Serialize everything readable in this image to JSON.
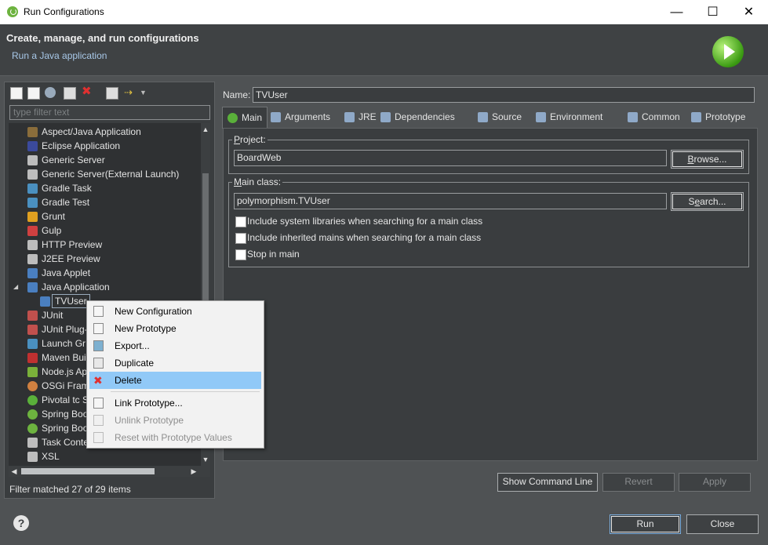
{
  "window": {
    "title": "Run Configurations",
    "controls": {
      "minimize": "—",
      "maximize": "☐",
      "close": "✕"
    }
  },
  "header": {
    "title": "Create, manage, and run configurations",
    "subtitle": "Run a Java application"
  },
  "left": {
    "filter_placeholder": "type filter text",
    "items": [
      {
        "label": "Aspect/Java Application",
        "icon": "aspectj-icon",
        "color": "#8a6d3b"
      },
      {
        "label": "Eclipse Application",
        "icon": "eclipse-icon",
        "color": "#3b4a9c"
      },
      {
        "label": "Generic Server",
        "icon": "server-icon",
        "color": "#bdbdbd"
      },
      {
        "label": "Generic Server(External Launch)",
        "icon": "server-icon",
        "color": "#bdbdbd"
      },
      {
        "label": "Gradle Task",
        "icon": "gradle-icon",
        "color": "#4a90c0"
      },
      {
        "label": "Gradle Test",
        "icon": "gradle-icon",
        "color": "#4a90c0"
      },
      {
        "label": "Grunt",
        "icon": "grunt-icon",
        "color": "#e0a020"
      },
      {
        "label": "Gulp",
        "icon": "gulp-icon",
        "color": "#d04040"
      },
      {
        "label": "HTTP Preview",
        "icon": "server-icon",
        "color": "#bdbdbd"
      },
      {
        "label": "J2EE Preview",
        "icon": "server-icon",
        "color": "#bdbdbd"
      },
      {
        "label": "Java Applet",
        "icon": "applet-icon",
        "color": "#4a7fc0"
      },
      {
        "label": "Java Application",
        "icon": "java-app-icon",
        "color": "#4a7fc0",
        "expanded": true
      },
      {
        "label": "TVUser",
        "icon": "java-app-icon",
        "color": "#4a7fc0",
        "child": true,
        "selected": true
      },
      {
        "label": "JUnit",
        "icon": "junit-icon",
        "color": "#c0504d"
      },
      {
        "label": "JUnit Plug-",
        "icon": "junit-icon",
        "color": "#c0504d"
      },
      {
        "label": "Launch Gr",
        "icon": "launch-group-icon",
        "color": "#4a90c0"
      },
      {
        "label": "Maven Bui",
        "icon": "maven-icon",
        "color": "#c03030"
      },
      {
        "label": "Node.js Ap",
        "icon": "nodejs-icon",
        "color": "#7ab03a"
      },
      {
        "label": "OSGi Fram",
        "icon": "osgi-icon",
        "color": "#d08040"
      },
      {
        "label": "Pivotal tc S",
        "icon": "pivotal-icon",
        "color": "#5ab03a"
      },
      {
        "label": "Spring Boo",
        "icon": "spring-boot-icon",
        "color": "#6db33f"
      },
      {
        "label": "Spring Boo",
        "icon": "spring-boot-icon",
        "color": "#6db33f"
      },
      {
        "label": "Task Conte",
        "icon": "task-icon",
        "color": "#bdbdbd"
      },
      {
        "label": "XSL",
        "icon": "xsl-icon",
        "color": "#bdbdbd"
      }
    ],
    "status": "Filter matched 27 of 29 items"
  },
  "config": {
    "name_label": "Name:",
    "name_value": "TVUser",
    "tabs": [
      {
        "label": "Main",
        "icon": "main-tab-icon"
      },
      {
        "label": "Arguments",
        "icon": "arguments-icon"
      },
      {
        "label": "JRE",
        "icon": "jre-icon"
      },
      {
        "label": "Dependencies",
        "icon": "dependencies-icon"
      },
      {
        "label": "Source",
        "icon": "source-icon"
      },
      {
        "label": "Environment",
        "icon": "environment-icon"
      },
      {
        "label": "Common",
        "icon": "common-icon"
      },
      {
        "label": "Prototype",
        "icon": "prototype-icon"
      }
    ],
    "project_label": "Project:",
    "project_value": "BoardWeb",
    "browse_button": "Browse...",
    "mainclass_label": "Main class:",
    "mainclass_value": "polymorphism.TVUser",
    "search_button": "Search...",
    "checkboxes": [
      {
        "label": "Include system libraries when searching for a main class",
        "checked": false
      },
      {
        "label": "Include inherited mains when searching for a main class",
        "checked": false
      },
      {
        "label": "Stop in main",
        "checked": false
      }
    ],
    "show_command_line": "Show Command Line",
    "revert": "Revert",
    "apply": "Apply"
  },
  "footer": {
    "help": "?",
    "run": "Run",
    "close": "Close"
  },
  "context_menu": {
    "items": [
      {
        "label": "New Configuration",
        "icon": "new-config-icon",
        "state": "normal"
      },
      {
        "label": "New Prototype",
        "icon": "new-prototype-icon",
        "state": "normal"
      },
      {
        "label": "Export...",
        "icon": "export-icon",
        "state": "normal"
      },
      {
        "label": "Duplicate",
        "icon": "duplicate-icon",
        "state": "normal"
      },
      {
        "label": "Delete",
        "icon": "delete-icon",
        "state": "selected"
      },
      {
        "label": "Link Prototype...",
        "icon": "link-prototype-icon",
        "state": "normal"
      },
      {
        "label": "Unlink Prototype",
        "icon": "unlink-prototype-icon",
        "state": "disabled"
      },
      {
        "label": "Reset with Prototype Values",
        "icon": "reset-icon",
        "state": "disabled"
      }
    ]
  }
}
